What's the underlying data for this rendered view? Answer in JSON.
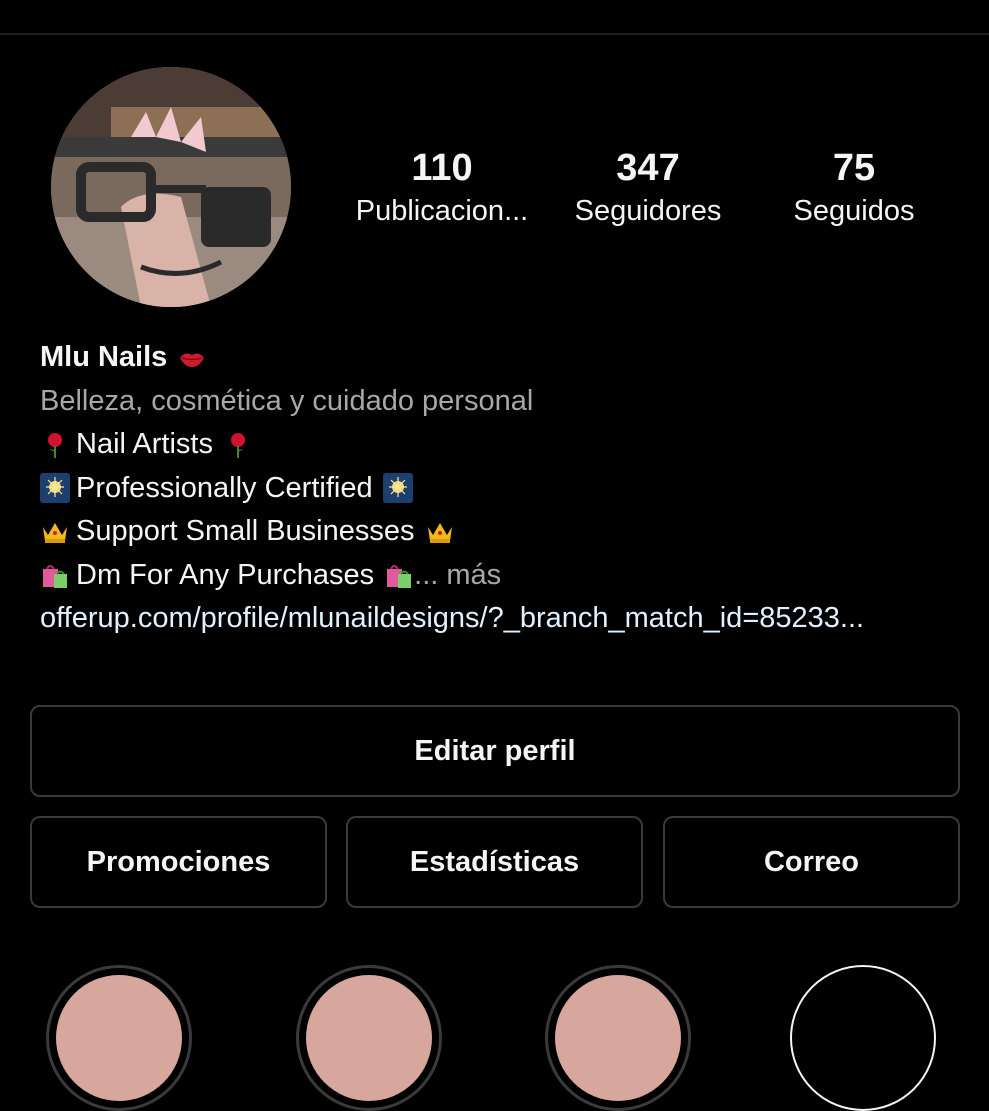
{
  "profile": {
    "stats": {
      "posts": {
        "count": "110",
        "label": "Publicacion..."
      },
      "followers": {
        "count": "347",
        "label": "Seguidores"
      },
      "following": {
        "count": "75",
        "label": "Seguidos"
      }
    },
    "name": "Mlu Nails",
    "category": "Belleza, cosmética y cuidado personal",
    "bio_lines": [
      {
        "text": "Nail Artists",
        "icon": "rose-icon"
      },
      {
        "text": "Professionally Certified",
        "icon": "sparkler-icon"
      },
      {
        "text": "Support Small Businesses",
        "icon": "crown-icon"
      },
      {
        "text": "Dm For Any Purchases",
        "icon": "shopping-bags-icon"
      }
    ],
    "more_label": "... más",
    "link": "offerup.com/profile/mlunaildesigns/?_branch_match_id=85233..."
  },
  "actions": {
    "edit_profile": "Editar perfil",
    "promotions": "Promociones",
    "insights": "Estadísticas",
    "email": "Correo"
  },
  "colors": {
    "background": "#000000",
    "text": "#f5f5f5",
    "secondary_text": "#a8a8a8",
    "link": "#e0f1ff",
    "button_border": "#3a3a3a",
    "highlight_fill": "#d7a79d"
  }
}
